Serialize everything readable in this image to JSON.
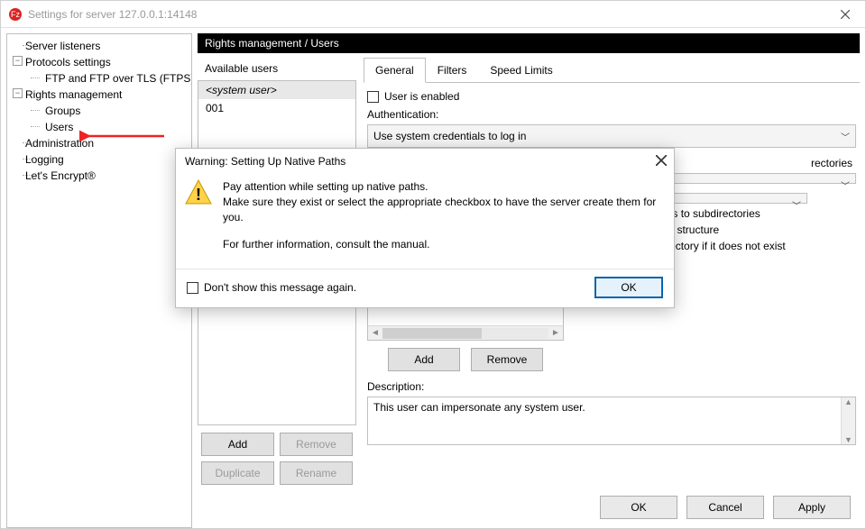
{
  "window": {
    "title": "Settings for server 127.0.0.1:14148"
  },
  "tree": {
    "server_listeners": "Server listeners",
    "protocols_settings": "Protocols settings",
    "ftp_ftps": "FTP and FTP over TLS (FTPS)",
    "rights_management": "Rights management",
    "groups": "Groups",
    "users": "Users",
    "administration": "Administration",
    "logging": "Logging",
    "lets_encrypt": "Let's Encrypt®"
  },
  "section": {
    "header": "Rights management / Users"
  },
  "users_panel": {
    "label": "Available users",
    "items": [
      "<system user>",
      "001"
    ],
    "add": "Add",
    "remove": "Remove",
    "duplicate": "Duplicate",
    "rename": "Rename"
  },
  "tabs": {
    "general": "General",
    "filters": "Filters",
    "speed_limits": "Speed Limits"
  },
  "general": {
    "enabled_label": "User is enabled",
    "auth_label": "Authentication:",
    "auth_value": "Use system credentials to log in",
    "directories_header": "rectories",
    "perm_combo_value": "",
    "perm_apply": "Apply permissions to subdirectories",
    "perm_writable": "Writable directory structure",
    "perm_create": "Create native directory if it does not exist",
    "mount_add": "Add",
    "mount_remove": "Remove",
    "description_label": "Description:",
    "description_value": "This user can impersonate any system user."
  },
  "dialog_buttons": {
    "ok": "OK",
    "cancel": "Cancel",
    "apply": "Apply"
  },
  "modal": {
    "title": "Warning: Setting Up Native Paths",
    "line1": "Pay attention while setting up native paths.",
    "line2": "Make sure they exist or select the appropriate checkbox to have the server create them for you.",
    "line3": "For further information, consult the manual.",
    "dont_show": "Don't show this message again.",
    "ok": "OK"
  },
  "icons": {
    "app": "filezilla-icon",
    "close": "close-icon",
    "warning": "warning-icon"
  }
}
